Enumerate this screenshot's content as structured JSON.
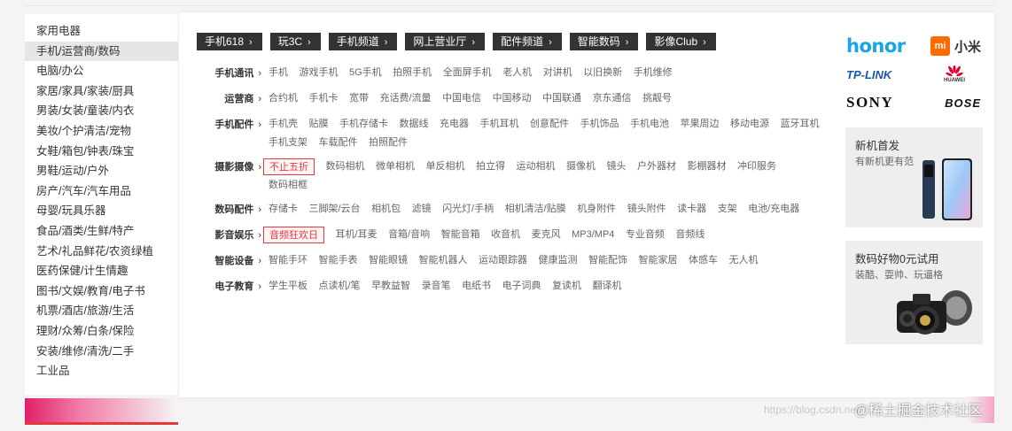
{
  "sidebar": {
    "items": [
      {
        "label": "家用电器"
      },
      {
        "label": "手机/运营商/数码",
        "active": true
      },
      {
        "label": "电脑/办公"
      },
      {
        "label": "家居/家具/家装/厨具"
      },
      {
        "label": "男装/女装/童装/内衣"
      },
      {
        "label": "美妆/个护清洁/宠物"
      },
      {
        "label": "女鞋/箱包/钟表/珠宝"
      },
      {
        "label": "男鞋/运动/户外"
      },
      {
        "label": "房产/汽车/汽车用品"
      },
      {
        "label": "母婴/玩具乐器"
      },
      {
        "label": "食品/酒类/生鲜/特产"
      },
      {
        "label": "艺术/礼品鲜花/农资绿植"
      },
      {
        "label": "医药保健/计生情趣"
      },
      {
        "label": "图书/文娱/教育/电子书"
      },
      {
        "label": "机票/酒店/旅游/生活"
      },
      {
        "label": "理财/众筹/白条/保险"
      },
      {
        "label": "安装/维修/清洗/二手"
      },
      {
        "label": "工业品"
      }
    ]
  },
  "tabs": [
    {
      "label": "手机618"
    },
    {
      "label": "玩3C"
    },
    {
      "label": "手机频道"
    },
    {
      "label": "网上营业厅"
    },
    {
      "label": "配件频道"
    },
    {
      "label": "智能数码"
    },
    {
      "label": "影像Club"
    }
  ],
  "chevron": "›",
  "rows": [
    {
      "label": "手机通讯",
      "items": [
        "手机",
        "游戏手机",
        "5G手机",
        "拍照手机",
        "全面屏手机",
        "老人机",
        "对讲机",
        "以旧换新",
        "手机维修"
      ]
    },
    {
      "label": "运营商",
      "items": [
        "合约机",
        "手机卡",
        "宽带",
        "充话费/流量",
        "中国电信",
        "中国移动",
        "中国联通",
        "京东通信",
        "挑靓号"
      ]
    },
    {
      "label": "手机配件",
      "items": [
        "手机壳",
        "贴膜",
        "手机存储卡",
        "数据线",
        "充电器",
        "手机耳机",
        "创意配件",
        "手机饰品",
        "手机电池",
        "苹果周边",
        "移动电源",
        "蓝牙耳机",
        "手机支架",
        "车载配件",
        "拍照配件"
      ]
    },
    {
      "label": "摄影摄像",
      "hot": "不止五折",
      "items": [
        "数码相机",
        "微单相机",
        "单反相机",
        "拍立得",
        "运动相机",
        "摄像机",
        "镜头",
        "户外器材",
        "影棚器材",
        "冲印服务",
        "数码相框"
      ]
    },
    {
      "label": "数码配件",
      "items": [
        "存储卡",
        "三脚架/云台",
        "相机包",
        "滤镜",
        "闪光灯/手柄",
        "相机清洁/贴膜",
        "机身附件",
        "镜头附件",
        "读卡器",
        "支架",
        "电池/充电器"
      ]
    },
    {
      "label": "影音娱乐",
      "hot": "音频狂欢日",
      "items": [
        "耳机/耳麦",
        "音箱/音响",
        "智能音箱",
        "收音机",
        "麦克风",
        "MP3/MP4",
        "专业音频",
        "音频线"
      ]
    },
    {
      "label": "智能设备",
      "items": [
        "智能手环",
        "智能手表",
        "智能眼镜",
        "智能机器人",
        "运动跟踪器",
        "健康监测",
        "智能配饰",
        "智能家居",
        "体感车",
        "无人机"
      ]
    },
    {
      "label": "电子教育",
      "items": [
        "学生平板",
        "点读机/笔",
        "早教益智",
        "录音笔",
        "电纸书",
        "电子词典",
        "复读机",
        "翻译机"
      ]
    }
  ],
  "brands": {
    "honor": "honor",
    "mi_logo": "mi",
    "mi": "小米",
    "tplink": "TP-LINK",
    "huawei": "HUAWEI",
    "sony": "SONY",
    "bose": "BOSE"
  },
  "promos": [
    {
      "title": "新机首发",
      "subtitle": "有新机更有范",
      "image": "smartphone"
    },
    {
      "title": "数码好物0元试用",
      "subtitle": "装酷、耍帅、玩逼格",
      "image": "camera"
    }
  ],
  "watermark": {
    "url": "https://blog.csdn.net/...",
    "text": "@稀土掘金技术社区"
  },
  "colors": {
    "accent": "#e4393c",
    "tab_bg": "#333333",
    "honor": "#1aa4e8",
    "mi": "#ff6a00"
  }
}
